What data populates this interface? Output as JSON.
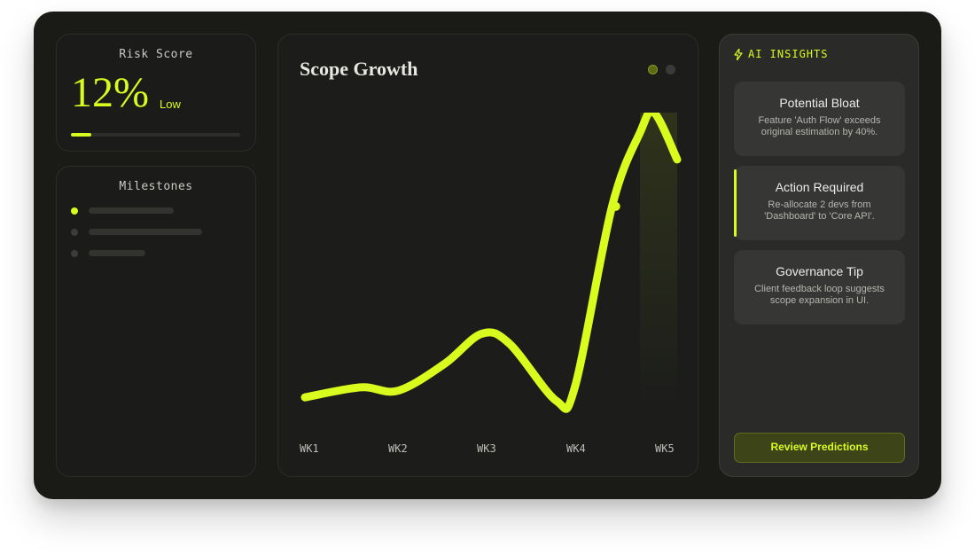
{
  "risk": {
    "title": "Risk Score",
    "value": "12%",
    "level": "Low",
    "progress": 0.12
  },
  "milestones": {
    "title": "Milestones",
    "items": [
      {
        "status": "active"
      },
      {
        "status": "pending"
      },
      {
        "status": "pending"
      }
    ]
  },
  "chart": {
    "pages": 2,
    "active_page": 1
  },
  "chart_data": {
    "type": "line",
    "title": "Scope Growth",
    "categories": [
      "WK1",
      "WK2",
      "WK3",
      "WK4",
      "WK5"
    ],
    "series": [
      {
        "x": [
          1.0,
          1.6,
          2.0,
          2.5,
          2.9,
          3.2,
          3.7,
          3.9,
          4.3,
          4.6,
          4.75,
          5.0
        ],
        "values": [
          0.05,
          0.2,
          0.15,
          0.55,
          1.0,
          0.85,
          0.0,
          0.2,
          2.9,
          4.0,
          4.3,
          3.6
        ]
      }
    ],
    "highlight": {
      "x": 4.34,
      "value": 2.9
    },
    "ylim": [
      0,
      4.3
    ],
    "grid": false,
    "color": "#d9fb1d"
  },
  "insights": {
    "title": "AI INSIGHTS",
    "cards": [
      {
        "title": "Potential Bloat",
        "body": "Feature 'Auth Flow' exceeds original estimation by 40%.",
        "accent": false
      },
      {
        "title": "Action Required",
        "body": "Re-allocate 2 devs from 'Dashboard' to 'Core API'.",
        "accent": true
      },
      {
        "title": "Governance Tip",
        "body": "Client feedback loop suggests scope expansion in UI.",
        "accent": false
      }
    ],
    "button_label": "Review Predictions"
  },
  "colors": {
    "accent": "#d9fb1d",
    "background": "#1a1b16",
    "panel": "#1b1c1a"
  }
}
